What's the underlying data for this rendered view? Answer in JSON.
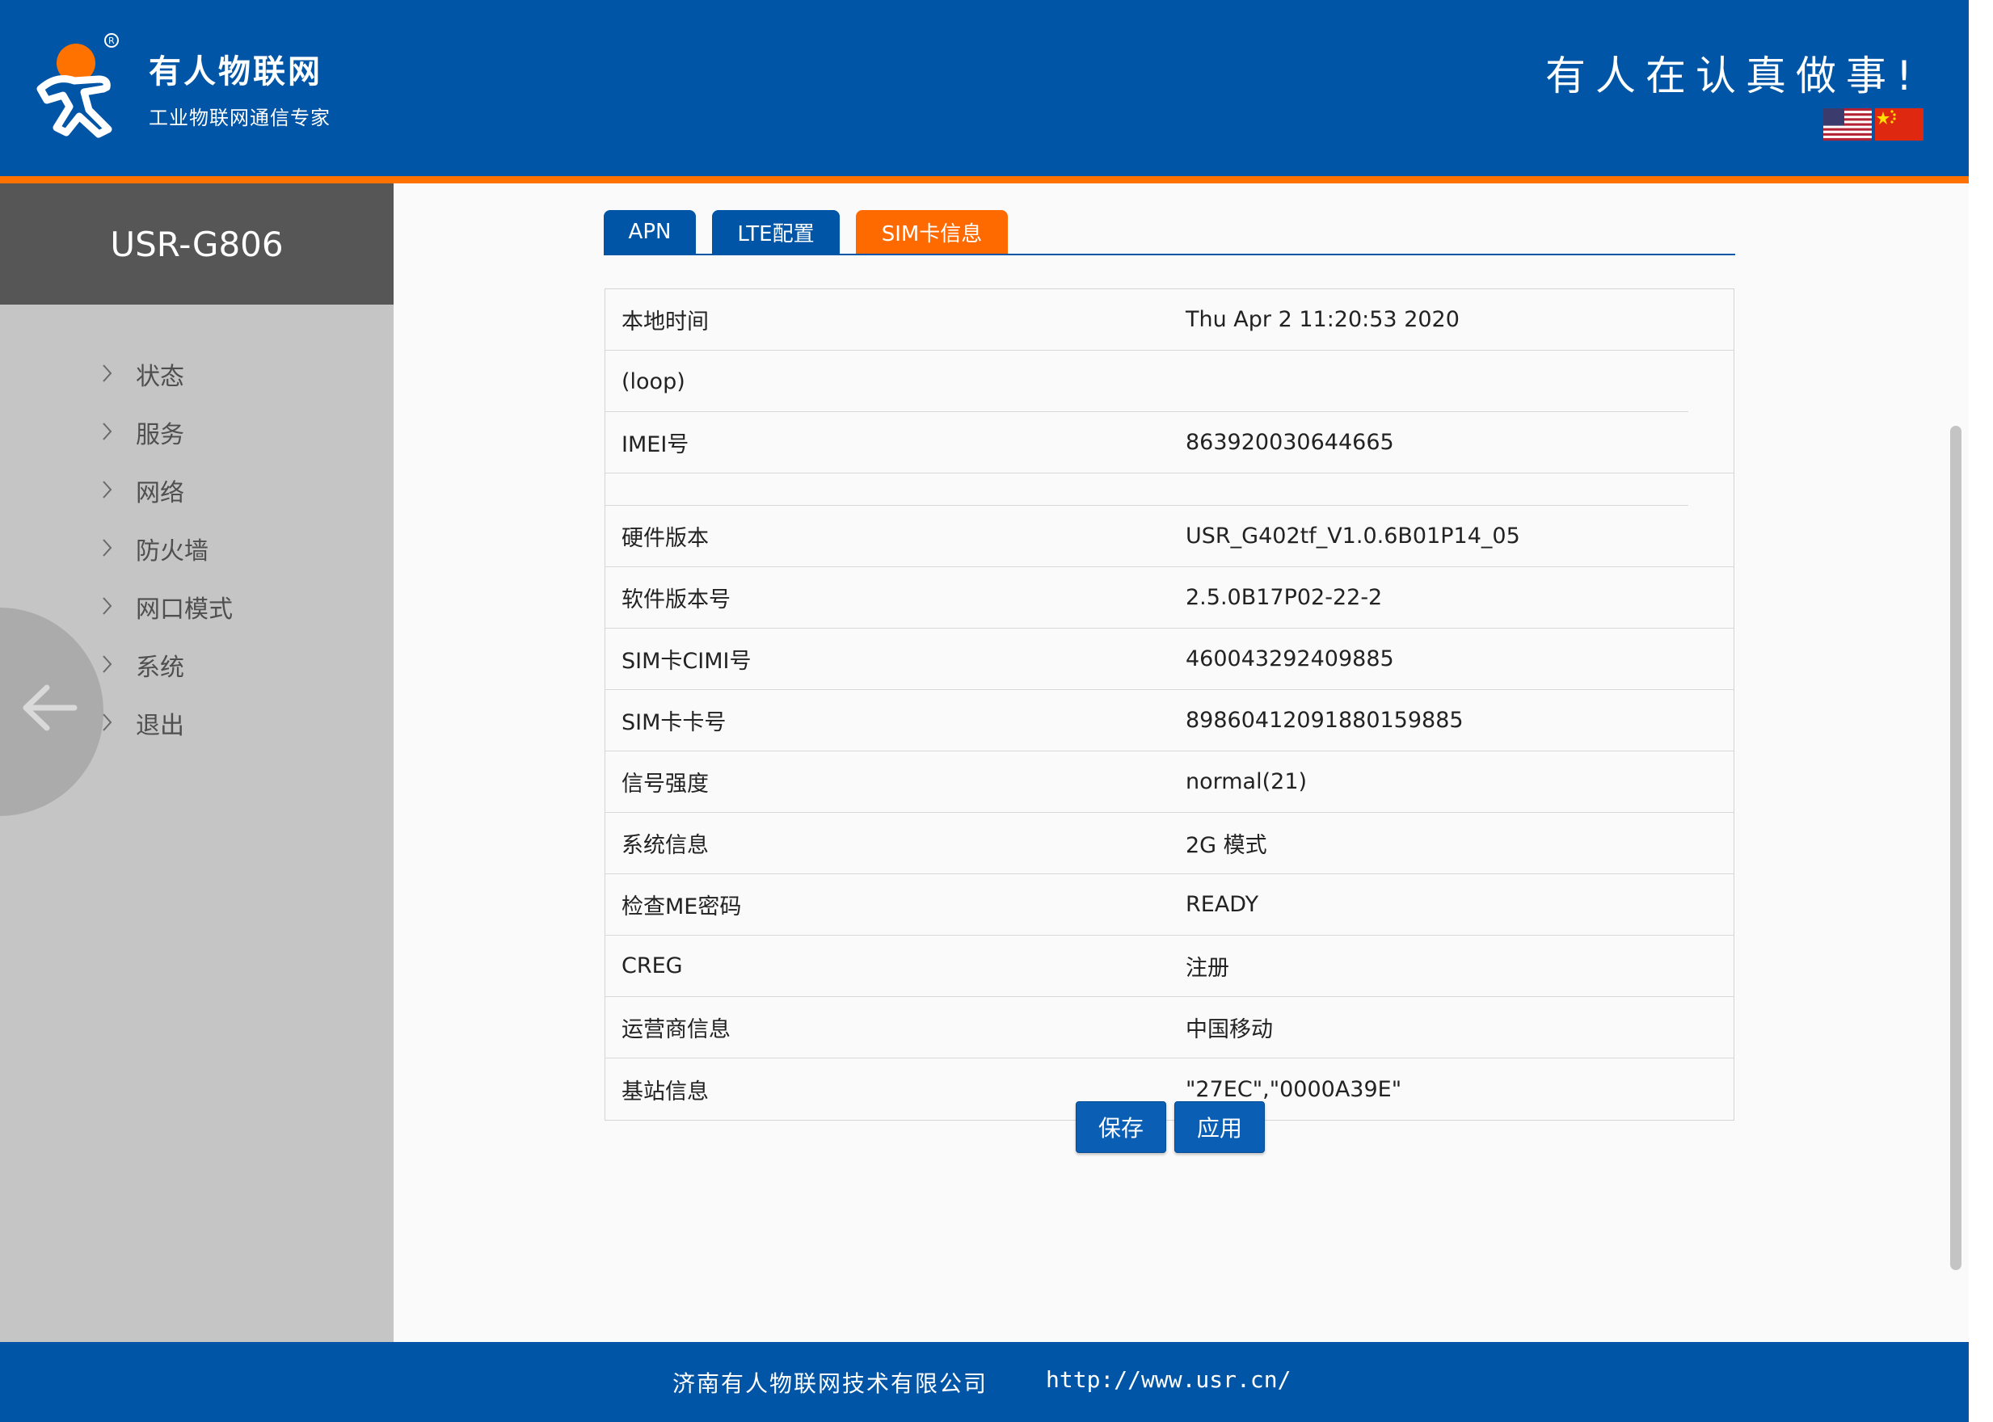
{
  "header": {
    "brand_name": "有人物联网",
    "brand_tagline": "工业物联网通信专家",
    "slogan": "有人在认真做事!",
    "colors": {
      "primary_blue": "#0055a6",
      "accent_orange": "#ff7200"
    },
    "flags": [
      {
        "icon": "us-flag-icon"
      },
      {
        "icon": "china-flag-icon"
      }
    ]
  },
  "sidebar": {
    "model": "USR-G806",
    "items": [
      {
        "label": "状态"
      },
      {
        "label": "服务"
      },
      {
        "label": "网络"
      },
      {
        "label": "防火墙"
      },
      {
        "label": "网口模式"
      },
      {
        "label": "系统"
      },
      {
        "label": "退出"
      }
    ]
  },
  "tabs": [
    {
      "label": "APN",
      "active": false
    },
    {
      "label": "LTE配置",
      "active": false
    },
    {
      "label": "SIM卡信息",
      "active": true
    }
  ],
  "info": [
    {
      "label": "本地时间",
      "value": "Thu Apr 2 11:20:53 2020"
    },
    {
      "label": "(loop)",
      "value": ""
    },
    {
      "label": "IMEI号",
      "value": "863920030644665"
    },
    {
      "label": "",
      "value": ""
    },
    {
      "label": "硬件版本",
      "value": "USR_G402tf_V1.0.6B01P14_05"
    },
    {
      "label": "软件版本号",
      "value": "2.5.0B17P02-22-2"
    },
    {
      "label": "SIM卡CIMI号",
      "value": "460043292409885"
    },
    {
      "label": "SIM卡卡号",
      "value": "89860412091880159885"
    },
    {
      "label": "信号强度",
      "value": "normal(21)"
    },
    {
      "label": "系统信息",
      "value": "2G 模式"
    },
    {
      "label": "检查ME密码",
      "value": "READY"
    },
    {
      "label": "CREG",
      "value": "注册"
    },
    {
      "label": "运营商信息",
      "value": "中国移动"
    },
    {
      "label": "基站信息",
      "value": "\"27EC\",\"0000A39E\""
    }
  ],
  "buttons": {
    "save": "保存",
    "apply": "应用"
  },
  "footer": {
    "company": "济南有人物联网技术有限公司",
    "url": "http://www.usr.cn/"
  }
}
